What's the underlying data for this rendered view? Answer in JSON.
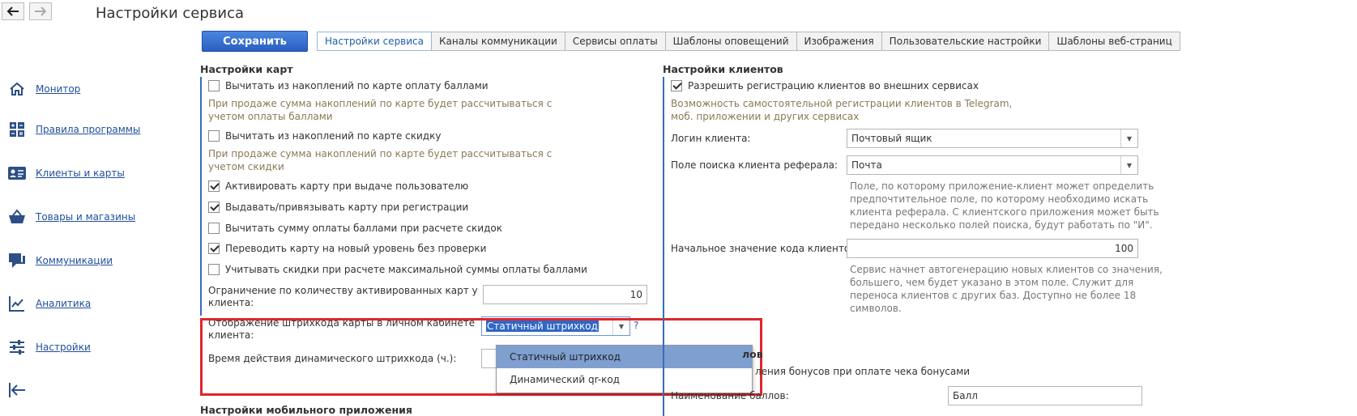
{
  "window": {
    "title": "Настройки сервиса"
  },
  "toolbar": {
    "save_label": "Сохранить"
  },
  "tabs": [
    {
      "label": "Настройки сервиса",
      "active": true
    },
    {
      "label": "Каналы коммуникации"
    },
    {
      "label": "Сервисы оплаты"
    },
    {
      "label": "Шаблоны оповещений"
    },
    {
      "label": "Изображения"
    },
    {
      "label": "Пользовательские настройки"
    },
    {
      "label": "Шаблоны веб-страниц"
    }
  ],
  "sidebar": {
    "items": [
      {
        "label": "Монитор",
        "icon": "home-icon"
      },
      {
        "label": "Правила программы",
        "icon": "calculator-icon"
      },
      {
        "label": "Клиенты и карты",
        "icon": "id-card-icon"
      },
      {
        "label": "Товары и магазины",
        "icon": "basket-icon"
      },
      {
        "label": "Коммуникации",
        "icon": "chat-icon"
      },
      {
        "label": "Аналитика",
        "icon": "chart-icon"
      },
      {
        "label": "Настройки",
        "icon": "sliders-icon"
      }
    ],
    "collapse_icon": "collapse-left-icon"
  },
  "cards": {
    "heading": "Настройки карт",
    "cb1": {
      "label": "Вычитать из накоплений по карте оплату баллами",
      "checked": false
    },
    "hint1_l1": "При продаже сумма накоплений по карте будет рассчитываться с",
    "hint1_l2": "учетом оплаты баллами",
    "cb2": {
      "label": "Вычитать из накоплений по карте скидку",
      "checked": false
    },
    "hint2_l1": "При продаже сумма накоплений по карте будет рассчитываться с",
    "hint2_l2": "учетом скидки",
    "cb3": {
      "label": "Активировать карту при выдаче пользователю",
      "checked": true
    },
    "cb4": {
      "label": "Выдавать/привязывать карту при регистрации",
      "checked": true
    },
    "cb5": {
      "label": "Вычитать сумму оплаты баллами при расчете скидок",
      "checked": false
    },
    "cb6": {
      "label": "Переводить карту на новый уровень без проверки",
      "checked": true
    },
    "cb7": {
      "label": "Учитывать скидки при расчете максимальной суммы оплаты баллами",
      "checked": false
    },
    "limit_label_l1": "Ограничение по количеству активированных карт у",
    "limit_label_l2": "клиента:",
    "limit_value": "10",
    "barcode_label_l1": "Отображение штрихкода карты в личном кабинете",
    "barcode_label_l2": "клиента:",
    "barcode_value": "Статичный штрихкод",
    "help": "?",
    "dyn_label": "Время действия динамического штрихкода (ч.):",
    "options": [
      "Статичный штрихкод",
      "Динамический qr-код"
    ]
  },
  "mobile": {
    "heading": "Настройки мобильного приложения"
  },
  "clients": {
    "heading": "Настройки клиентов",
    "cb_reg": {
      "label": "Разрешить регистрацию клиентов во внешних сервисах",
      "checked": true
    },
    "hint_reg_l1": "Возможность самостоятельной регистрации клиентов в Telegram,",
    "hint_reg_l2": "моб. приложении и других сервисах",
    "login_label": "Логин клиента:",
    "login_value": "Почтовый ящик",
    "ref_label": "Поле поиска клиента реферала:",
    "ref_value": "Почта",
    "ref_hint": [
      "Поле, по которому приложение-клиент может определить",
      "предпочтительное поле, по которому необходимо искать",
      "клиента реферала. С клиентского приложения может быть",
      "передано несколько полей поиска, будут работать по \"И\"."
    ],
    "code_label": "Начальное значение кода клиентов:",
    "code_value": "100",
    "code_hint": [
      "Сервис начнет автогенерацию новых клиентов со значения,",
      "большего, чем будет указано в этом поле. Служит для",
      "переноса клиентов с других баз. Доступно не более 18",
      "символов."
    ]
  },
  "bonus": {
    "heading_tail": "лов",
    "cb_tail": "ления бонусов при оплате чека бонусами",
    "name_label": "Наименование баллов:",
    "name_value": "Балл"
  }
}
